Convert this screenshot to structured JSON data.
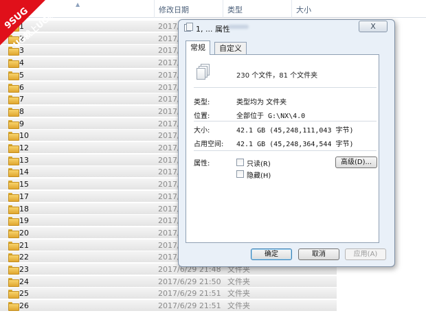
{
  "columns": {
    "date": "修改日期",
    "type": "类型",
    "size": "大小"
  },
  "watermark": {
    "line1": "9SUG",
    "line2": "学UG就上UG网"
  },
  "rows": [
    {
      "name": "1",
      "date": "2017/",
      "type": ""
    },
    {
      "name": "2",
      "date": "2017/",
      "type": ""
    },
    {
      "name": "3",
      "date": "2017/",
      "type": ""
    },
    {
      "name": "4",
      "date": "2017/",
      "type": ""
    },
    {
      "name": "5",
      "date": "2017/",
      "type": ""
    },
    {
      "name": "6",
      "date": "2017/",
      "type": ""
    },
    {
      "name": "7",
      "date": "2017/",
      "type": ""
    },
    {
      "name": "8",
      "date": "2017/",
      "type": ""
    },
    {
      "name": "9",
      "date": "2017/",
      "type": ""
    },
    {
      "name": "10",
      "date": "2017/",
      "type": ""
    },
    {
      "name": "12",
      "date": "2017/",
      "type": ""
    },
    {
      "name": "13",
      "date": "2017/",
      "type": ""
    },
    {
      "name": "14",
      "date": "2017/",
      "type": ""
    },
    {
      "name": "15",
      "date": "2017/",
      "type": ""
    },
    {
      "name": "17",
      "date": "2017/",
      "type": ""
    },
    {
      "name": "18",
      "date": "2017/",
      "type": ""
    },
    {
      "name": "19",
      "date": "2017/",
      "type": ""
    },
    {
      "name": "20",
      "date": "2017/",
      "type": ""
    },
    {
      "name": "21",
      "date": "2017/",
      "type": ""
    },
    {
      "name": "22",
      "date": "2017/",
      "type": ""
    },
    {
      "name": "23",
      "date": "2017/6/29 21:48",
      "type": "文件夹"
    },
    {
      "name": "24",
      "date": "2017/6/29 21:50",
      "type": "文件夹"
    },
    {
      "name": "25",
      "date": "2017/6/29 21:51",
      "type": "文件夹"
    },
    {
      "name": "26",
      "date": "2017/6/29 21:51",
      "type": "文件夹"
    }
  ],
  "dialog": {
    "title": "1, ... 属性",
    "close": "X",
    "tabs": {
      "general": "常规",
      "custom": "自定义"
    },
    "summary": "230 个文件，81 个文件夹",
    "type_label": "类型:",
    "type_value": "类型均为 文件夹",
    "location_label": "位置:",
    "location_value": "全部位于 G:\\NX\\4.0",
    "size_label": "大小:",
    "size_value": "42.1 GB (45,248,111,043 字节)",
    "disk_label": "占用空间:",
    "disk_value": "42.1 GB (45,248,364,544 字节)",
    "attrs_label": "属性:",
    "readonly_label": "只读(R)",
    "hidden_label": "隐藏(H)",
    "advanced_button": "高级(D)...",
    "ok": "确定",
    "cancel": "取消",
    "apply": "应用(A)"
  }
}
